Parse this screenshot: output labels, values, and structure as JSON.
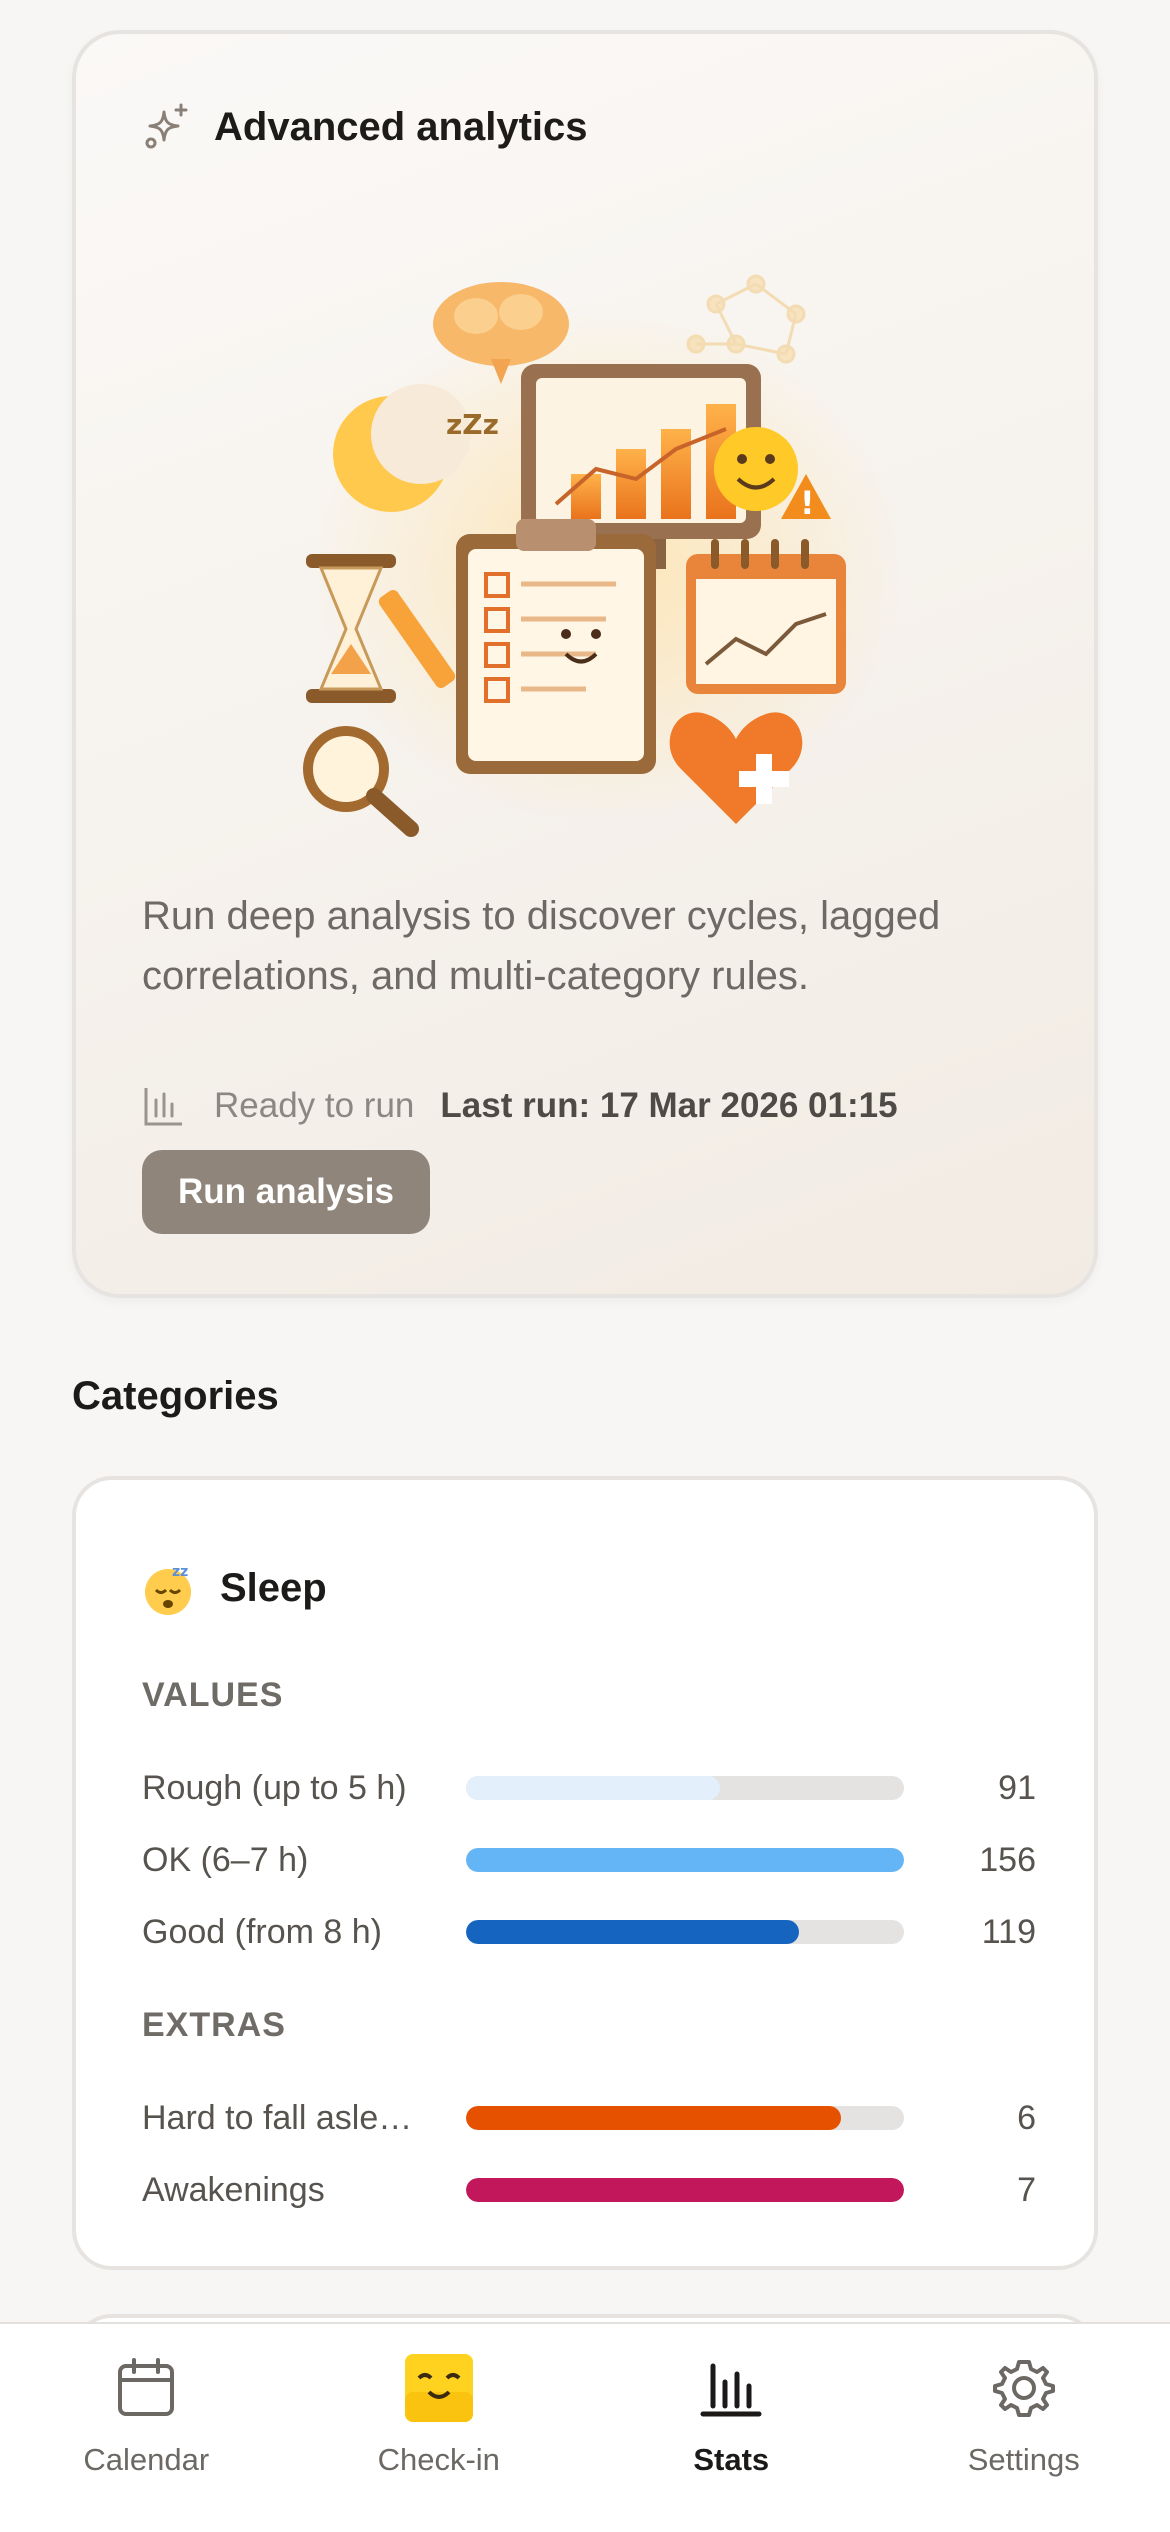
{
  "analytics": {
    "title": "Advanced analytics",
    "icon": "sparkles-icon",
    "description": "Run deep analysis to discover cycles, lagged correlations, and multi-category rules.",
    "status": "Ready to run",
    "last_run": "Last run: 17 Mar 2026 01:15",
    "run_button": "Run analysis"
  },
  "categories": {
    "section_title": "Categories",
    "sleep": {
      "emoji": "sleeping-face-icon",
      "title": "Sleep",
      "values_label": "VALUES",
      "values": [
        {
          "label": "Rough (up to 5 h)",
          "count": "91",
          "fraction": 0.58,
          "color": "#e3effb"
        },
        {
          "label": "OK (6–7 h)",
          "count": "156",
          "fraction": 1.0,
          "color": "#64b5f6"
        },
        {
          "label": "Good (from 8 h)",
          "count": "119",
          "fraction": 0.76,
          "color": "#1565c0"
        }
      ],
      "extras_label": "EXTRAS",
      "extras": [
        {
          "label": "Hard to fall asle…",
          "count": "6",
          "fraction": 0.857,
          "color": "#e65100"
        },
        {
          "label": "Awakenings",
          "count": "7",
          "fraction": 1.0,
          "color": "#c2185b"
        }
      ]
    }
  },
  "nav": {
    "items": [
      {
        "label": "Calendar",
        "icon": "calendar-icon",
        "active": false
      },
      {
        "label": "Check-in",
        "icon": "smiley-face-icon",
        "active": false
      },
      {
        "label": "Stats",
        "icon": "bar-chart-icon",
        "active": true
      },
      {
        "label": "Settings",
        "icon": "gear-icon",
        "active": false
      }
    ]
  }
}
